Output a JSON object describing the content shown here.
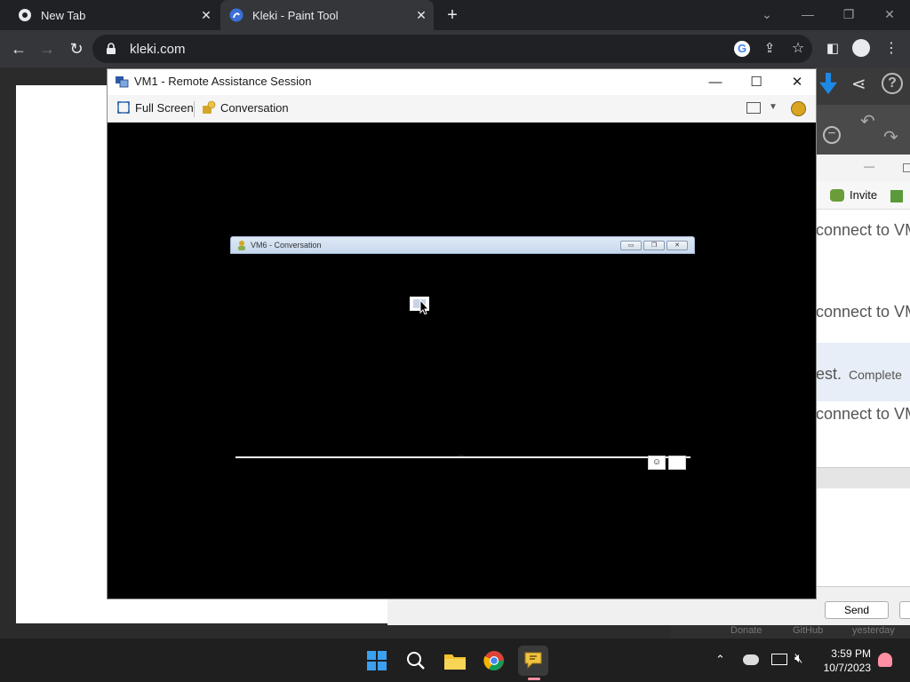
{
  "browser": {
    "tabs": [
      {
        "label": "New Tab",
        "active": false
      },
      {
        "label": "Kleki - Paint Tool",
        "active": true
      }
    ],
    "url": "kleki.com"
  },
  "remote_window": {
    "title": "VM1 - Remote Assistance Session",
    "toolbar": {
      "fullscreen_label": "Full Screen",
      "conversation_label": "Conversation"
    },
    "inner_window_title": "VM6 - Conversation"
  },
  "background_app": {
    "invite_label": "Invite",
    "lines": [
      "connect to VM",
      "connect to VM",
      "est.",
      "connect to VM"
    ],
    "complete_label": "Complete",
    "send_label": "Send",
    "footer_items": [
      "Donate",
      "GitHub",
      "yesterday"
    ]
  },
  "taskbar": {
    "time": "3:59 PM",
    "date": "10/7/2023"
  },
  "colors": {
    "chrome_dark": "#202124",
    "chrome_toolbar": "#35363a",
    "remote_screen": "#000000"
  }
}
